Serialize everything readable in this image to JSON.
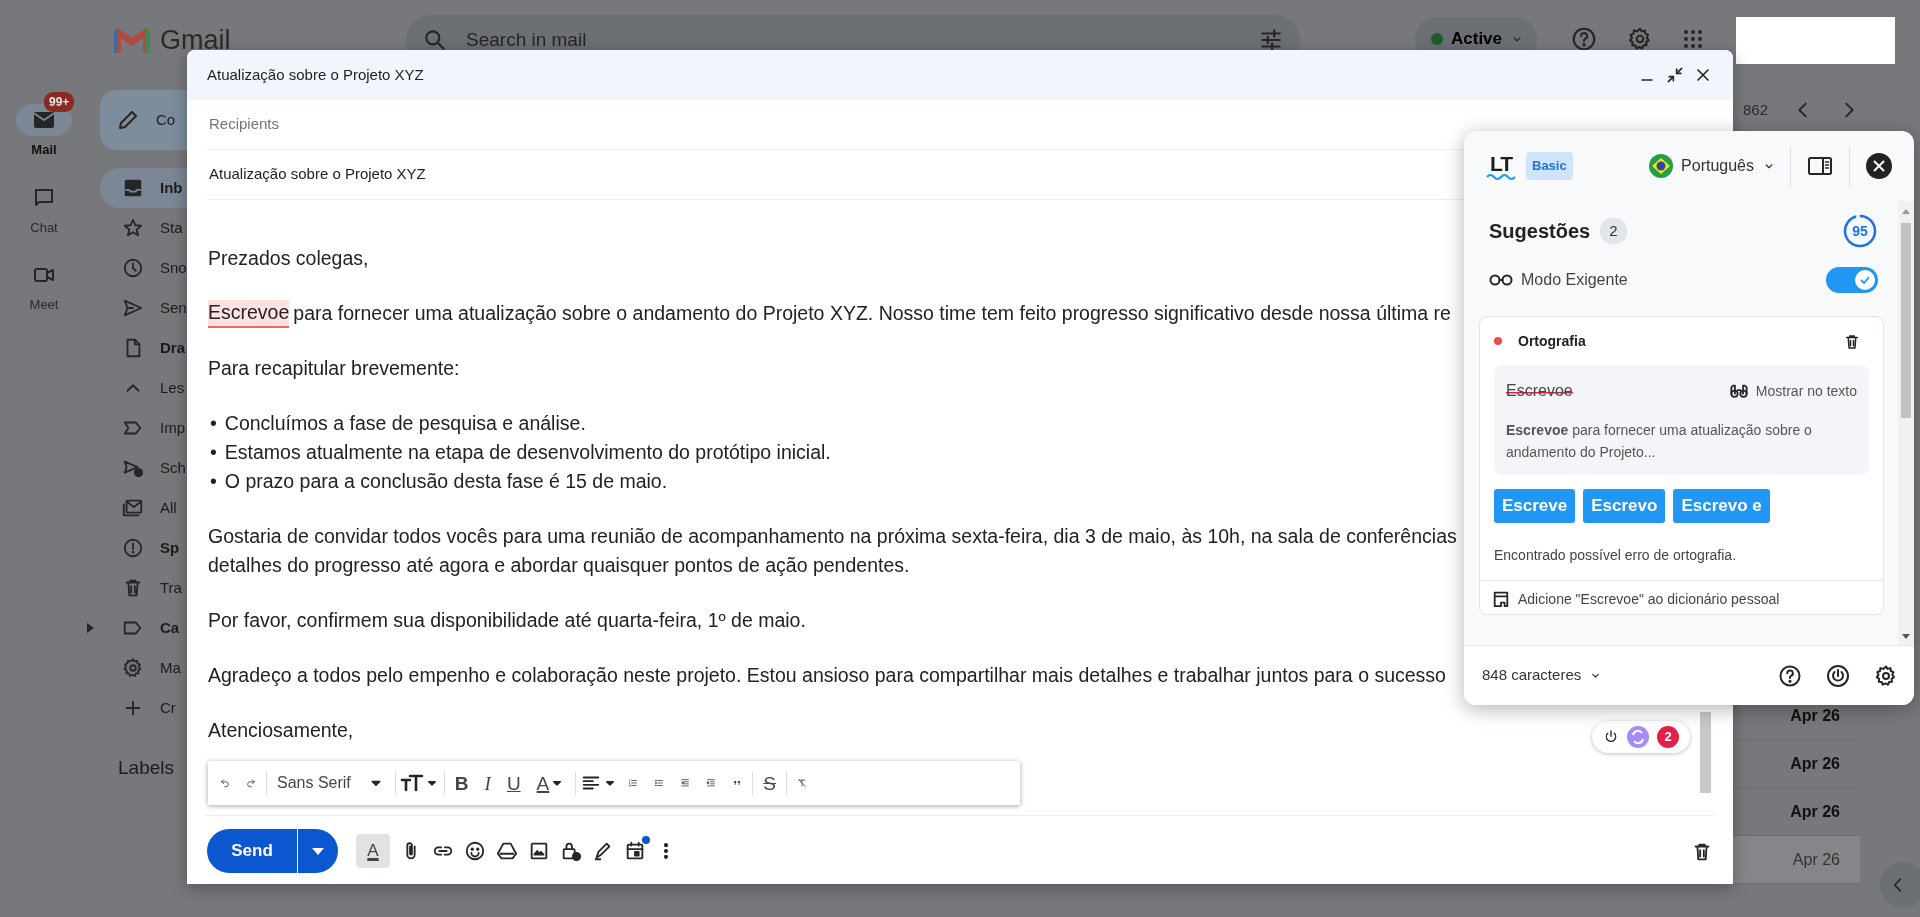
{
  "gmail": {
    "logo_text": "Gmail",
    "search": {
      "placeholder": "Search in mail"
    },
    "status": "Active",
    "rail": [
      {
        "label": "Mail",
        "badge": "99+",
        "selected": true
      },
      {
        "label": "Chat",
        "selected": false
      },
      {
        "label": "Meet",
        "selected": false
      }
    ],
    "compose_button": "Co",
    "nav": [
      {
        "label": "Inb",
        "bold": true,
        "selected": true,
        "collapsed": false
      },
      {
        "label": "Sta",
        "bold": false,
        "selected": false,
        "collapsed": false
      },
      {
        "label": "Sno",
        "bold": false,
        "selected": false,
        "collapsed": false
      },
      {
        "label": "Sen",
        "bold": false,
        "selected": false,
        "collapsed": false
      },
      {
        "label": "Dra",
        "bold": true,
        "selected": false,
        "collapsed": false
      },
      {
        "label": "Les",
        "bold": false,
        "selected": false,
        "collapsed": false
      },
      {
        "label": "Imp",
        "bold": false,
        "selected": false,
        "collapsed": false
      },
      {
        "label": "Sch",
        "bold": false,
        "selected": false,
        "collapsed": false
      },
      {
        "label": "All",
        "bold": false,
        "selected": false,
        "collapsed": false
      },
      {
        "label": "Sp",
        "bold": true,
        "selected": false,
        "collapsed": false
      },
      {
        "label": "Tra",
        "bold": false,
        "selected": false,
        "collapsed": false
      },
      {
        "label": "Ca",
        "bold": true,
        "selected": false,
        "collapsed": true
      },
      {
        "label": "Ma",
        "bold": false,
        "selected": false,
        "collapsed": false
      },
      {
        "label": "Cr",
        "bold": false,
        "selected": false,
        "collapsed": false
      }
    ],
    "labels_heading": "Labels",
    "pagination": "862",
    "dates": [
      {
        "text": "Apr 26",
        "unread": true,
        "highlighted": false
      },
      {
        "text": "Apr 26",
        "unread": true,
        "highlighted": false
      },
      {
        "text": "Apr 26",
        "unread": true,
        "highlighted": false
      },
      {
        "text": "Apr 26",
        "unread": false,
        "highlighted": true
      }
    ]
  },
  "compose": {
    "title": "Atualização sobre o Projeto XYZ",
    "recipients": {
      "placeholder": "Recipients"
    },
    "subject": "Atualização sobre o Projeto XYZ",
    "body": [
      {
        "kind": "paragraph",
        "lines": [
          "Prezados colegas,"
        ]
      },
      {
        "kind": "flagged",
        "flagged": "Escrevoe",
        "text": "para fornecer uma atualização sobre o andamento do Projeto XYZ. Nosso time tem feito progresso significativo desde nossa última re"
      },
      {
        "kind": "paragraph",
        "lines": [
          "Para recapitular brevemente:"
        ]
      },
      {
        "kind": "list",
        "marker": "•",
        "items": [
          "Concluímos a fase de pesquisa e análise.",
          "Estamos atualmente na etapa de desenvolvimento do protótipo inicial.",
          "O prazo para a conclusão desta fase é 15 de maio."
        ]
      },
      {
        "kind": "paragraph",
        "lines": [
          "Gostaria de convidar todos vocês para uma reunião de acompanhamento na próxima sexta-feira, dia 3 de maio, às 10h, na sala de conferências",
          "detalhes do progresso até agora e abordar quaisquer pontos de ação pendentes."
        ]
      },
      {
        "kind": "paragraph",
        "lines": [
          "Por favor, confirmem sua disponibilidade até quarta-feira, 1º de maio."
        ]
      },
      {
        "kind": "paragraph",
        "lines": [
          "Agradeço a todos pelo empenho e colaboração neste projeto. Estou ansioso para compartilhar mais detalhes e trabalhar juntos para o sucesso"
        ]
      },
      {
        "kind": "paragraph",
        "lines": [
          "Atenciosamente,"
        ]
      }
    ],
    "lt_badge_count": "2",
    "format_toolbar": {
      "font": "Sans Serif",
      "bold": "B",
      "italic": "I",
      "underline": "U",
      "text_color": "A",
      "strikethrough": "S"
    },
    "send": "Send",
    "formatting_button": "A"
  },
  "lt": {
    "logo": "LT",
    "plan": "Basic",
    "language": "Português",
    "heading": "Sugestões",
    "count": "2",
    "score": {
      "text": "95",
      "level": 0.95
    },
    "strict_mode": {
      "label": "Modo Exigente",
      "on": true
    },
    "card": {
      "category": "Ortografia",
      "color": "#ea4c4c",
      "original": "Escrevoe",
      "show_in_text": "Mostrar no texto",
      "context": "**Escrevoe** para fornecer uma atualização sobre o andamento do Projeto...",
      "suggestions": [
        "Escreve",
        "Escrevo",
        "Escrevo e"
      ],
      "message": "Encontrado possível erro de ortografia.",
      "add_to_dictionary": "Adicione \"Escrevoe\" ao dicionário pessoal"
    },
    "characters": "848 caracteres"
  }
}
